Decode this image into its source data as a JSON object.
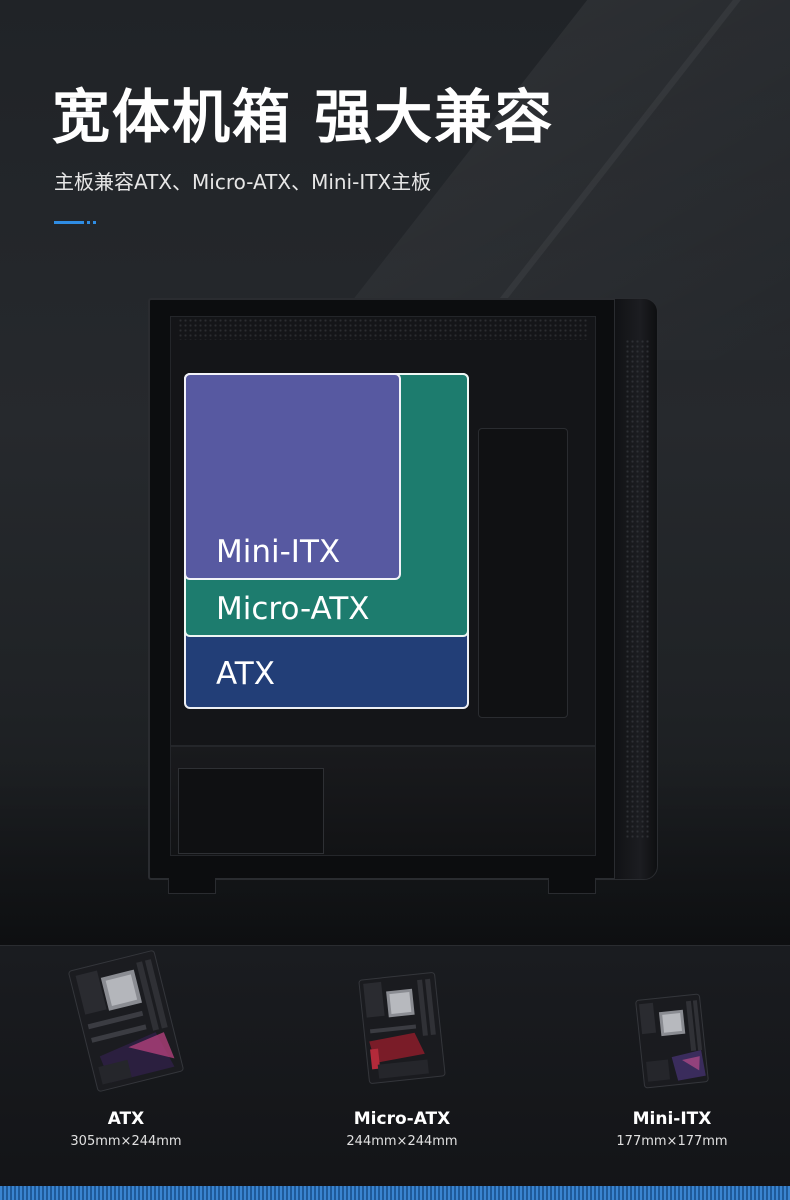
{
  "header": {
    "title": "宽体机箱 强大兼容",
    "subtitle": "主板兼容ATX、Micro-ATX、Mini-ITX主板"
  },
  "form_factors": {
    "atx_label": "ATX",
    "micro_label": "Micro-ATX",
    "mini_label": "Mini-ITX"
  },
  "boards": [
    {
      "name": "ATX",
      "size": "305mm×244mm"
    },
    {
      "name": "Micro-ATX",
      "size": "244mm×244mm"
    },
    {
      "name": "Mini-ITX",
      "size": "177mm×177mm"
    }
  ],
  "colors": {
    "accent": "#2f8de4",
    "atx": "#26488c",
    "micro_atx": "#1c8e6c",
    "mini_itx": "#6054a8"
  }
}
